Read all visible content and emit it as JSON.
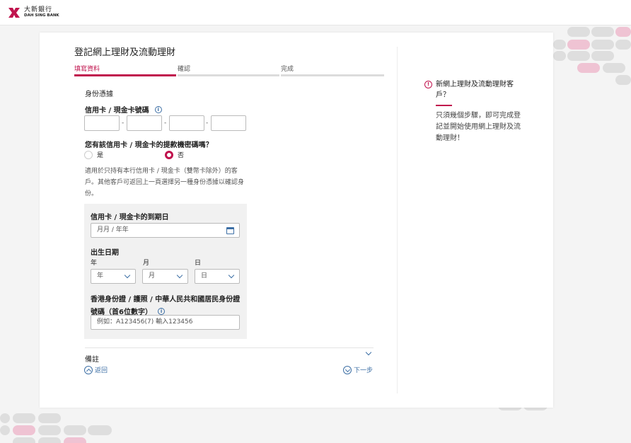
{
  "brand": {
    "name_cn": "大新銀行",
    "name_en": "DAH SING BANK",
    "color": "#c0134d"
  },
  "page": {
    "title": "登記網上理財及流動理財"
  },
  "steps": [
    {
      "label": "填寫資料",
      "active": true
    },
    {
      "label": "確認",
      "active": false
    },
    {
      "label": "完成",
      "active": false
    }
  ],
  "identity": {
    "section_title": "身份憑據",
    "card_label": "信用卡 / 現金卡號碼",
    "card_separator": "-",
    "pin_question": "您有該信用卡 / 現金卡的提款機密碼嗎？",
    "yes_label": "是",
    "no_label": "否",
    "selected": "否",
    "note": "適用於只持有本行信用卡 / 現金卡（雙幣卡除外）的客戶。其他客戶可返回上一頁選擇另一種身份憑據以確認身份。"
  },
  "expiry": {
    "label": "信用卡 / 現金卡的到期日",
    "placeholder": "月月 / 年年"
  },
  "dob": {
    "label": "出生日期",
    "year_label": "年",
    "month_label": "月",
    "day_label": "日",
    "year_value": "年",
    "month_value": "月",
    "day_value": "日"
  },
  "idnum": {
    "label": "香港身份證 / 護照 / 中華人民共和國居民身份證號碼（首6位數字）",
    "placeholder": "例如：A123456(7) 輸入123456"
  },
  "remarks": {
    "label": "備註"
  },
  "nav": {
    "back_label": "返回",
    "next_label": "下一步"
  },
  "sidebar": {
    "heading": "新網上理財及流動理財客戶？",
    "body": "只須幾個步驟，即可完成登記並開始使用網上理財及流動理財！"
  }
}
